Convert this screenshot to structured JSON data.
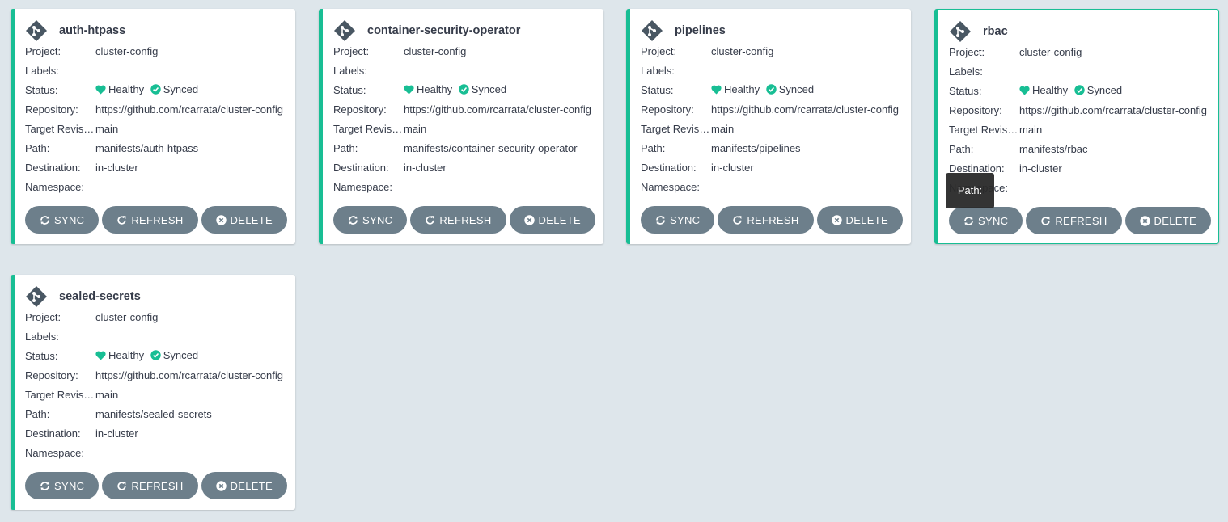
{
  "field_labels": {
    "project": "Project:",
    "labels": "Labels:",
    "status": "Status:",
    "repository": "Repository:",
    "target_revision": "Target Revision:",
    "path": "Path:",
    "destination": "Destination:",
    "namespace": "Namespace:"
  },
  "buttons": {
    "sync": "SYNC",
    "refresh": "REFRESH",
    "delete": "DELETE"
  },
  "status_health": "Healthy",
  "status_sync": "Synced",
  "colors": {
    "accent": "#18be94",
    "button": "#6d7f8b",
    "background": "#dee6eb"
  },
  "apps": [
    {
      "name": "auth-htpass",
      "project": "cluster-config",
      "labels": "",
      "repository": "https://github.com/rcarrata/cluster-config",
      "target_revision": "main",
      "path": "manifests/auth-htpass",
      "destination": "in-cluster",
      "namespace": ""
    },
    {
      "name": "container-security-operator",
      "project": "cluster-config",
      "labels": "",
      "repository": "https://github.com/rcarrata/cluster-config",
      "target_revision": "main",
      "path": "manifests/container-security-operator",
      "destination": "in-cluster",
      "namespace": ""
    },
    {
      "name": "pipelines",
      "project": "cluster-config",
      "labels": "",
      "repository": "https://github.com/rcarrata/cluster-config",
      "target_revision": "main",
      "path": "manifests/pipelines",
      "destination": "in-cluster",
      "namespace": ""
    },
    {
      "name": "rbac",
      "project": "cluster-config",
      "labels": "",
      "repository": "https://github.com/rcarrata/cluster-config",
      "target_revision": "main",
      "path": "manifests/rbac",
      "destination": "in-cluster",
      "namespace": ""
    },
    {
      "name": "sealed-secrets",
      "project": "cluster-config",
      "labels": "",
      "repository": "https://github.com/rcarrata/cluster-config",
      "target_revision": "main",
      "path": "manifests/sealed-secrets",
      "destination": "in-cluster",
      "namespace": ""
    }
  ],
  "tooltip": {
    "text": "Path:"
  }
}
